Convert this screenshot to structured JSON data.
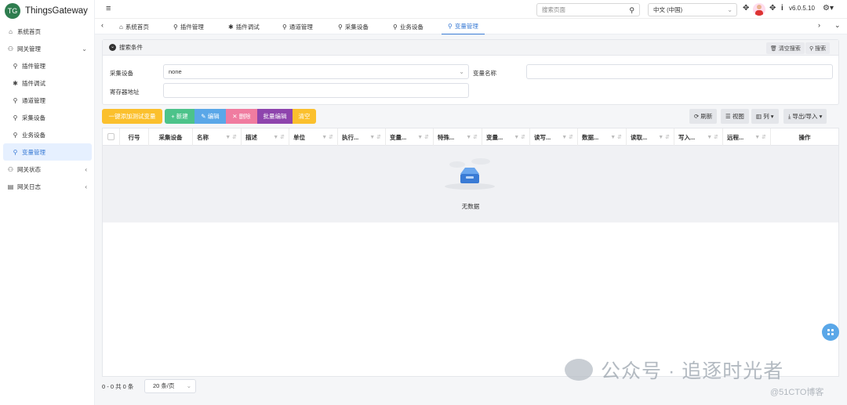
{
  "app": {
    "logo_text": "TG",
    "title": "ThingsGateway"
  },
  "sidebar": {
    "items": [
      {
        "label": "系统首页",
        "icon": "home-icon"
      },
      {
        "label": "网关管理",
        "icon": "gateway-group-icon"
      },
      {
        "label": "插件管理",
        "icon": "plugin-icon"
      },
      {
        "label": "插件调试",
        "icon": "bug-icon"
      },
      {
        "label": "通道管理",
        "icon": "channel-icon"
      },
      {
        "label": "采集设备",
        "icon": "collect-device-icon"
      },
      {
        "label": "业务设备",
        "icon": "business-device-icon"
      },
      {
        "label": "变量管理",
        "icon": "variable-icon"
      },
      {
        "label": "网关状态",
        "icon": "status-icon"
      },
      {
        "label": "网关日志",
        "icon": "log-icon"
      }
    ]
  },
  "topbar": {
    "search_placeholder": "搜索页面",
    "language": "中文 (中国)",
    "version": "v6.0.5.10"
  },
  "tabs": [
    {
      "label": "系统首页"
    },
    {
      "label": "插件管理"
    },
    {
      "label": "插件调试"
    },
    {
      "label": "通道管理"
    },
    {
      "label": "采集设备"
    },
    {
      "label": "业务设备"
    },
    {
      "label": "变量管理"
    }
  ],
  "search_panel": {
    "title": "搜索条件",
    "clear_label": "清空搜索",
    "search_label": "搜索",
    "collect_device_label": "采集设备",
    "collect_device_value": "none",
    "variable_name_label": "变量名称",
    "register_address_label": "寄存器地址"
  },
  "toolbar": {
    "add_test_label": "一键添加测试变量",
    "new_label": "新建",
    "edit_label": "编辑",
    "delete_label": "删除",
    "batch_edit_label": "批量编辑",
    "clear_label": "清空",
    "refresh_label": "刷新",
    "view_label": "视图",
    "columns_label": "列",
    "export_label": "导出/导入"
  },
  "table": {
    "columns": [
      "行号",
      "采集设备",
      "名称",
      "描述",
      "单位",
      "执行...",
      "变量...",
      "特殊...",
      "变量...",
      "读写...",
      "数据...",
      "读取...",
      "写入...",
      "远程...",
      "操作"
    ],
    "empty_text": "无数据"
  },
  "pagination": {
    "info": "0 - 0 共 0 条",
    "page_size": "20 条/页"
  },
  "watermark": {
    "text": "公众号 · 追逐时光者",
    "source": "@51CTO博客"
  }
}
